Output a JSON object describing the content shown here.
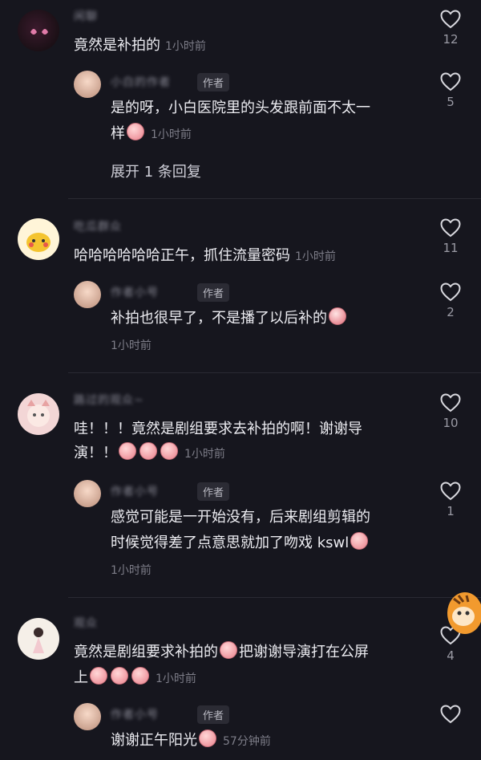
{
  "author_tag": "作者",
  "threads": [
    {
      "name": "闲聊",
      "text": "竟然是补拍的",
      "time": "1小时前",
      "likes": "12",
      "reply": {
        "name": "小白的作者",
        "text_line1": "是的呀，小白医院里的头发跟前面不太一",
        "text_line2": "样",
        "time": "1小时前",
        "likes": "5"
      },
      "expand": "展开 1 条回复"
    },
    {
      "name": "吃瓜群众",
      "text": "哈哈哈哈哈哈正午，抓住流量密码",
      "time": "1小时前",
      "likes": "11",
      "reply": {
        "name": "作者小号",
        "text": "补拍也很早了，不是播了以后补的",
        "time": "1小时前",
        "likes": "2"
      }
    },
    {
      "name": "路过的观众~",
      "text_line1": "哇！！！竟然是剧组要求去补拍的啊！谢谢导",
      "text_line2": "演！！",
      "time": "1小时前",
      "likes": "10",
      "reply": {
        "name": "作者小号",
        "text_line1": "感觉可能是一开始没有，后来剧组剪辑的",
        "text_line2": "时候觉得差了点意思就加了吻戏 kswl",
        "time": "1小时前",
        "likes": "1"
      }
    },
    {
      "name": "观众",
      "text_line1": "竟然是剧组要求补拍的",
      "text_line1b": "把谢谢导演打在公屏",
      "text_line2": "上",
      "time": "1小时前",
      "likes": "4",
      "reply": {
        "name": "作者小号",
        "text": "谢谢正午阳光",
        "time": "57分钟前"
      }
    }
  ],
  "colors": {
    "background": "#16161e",
    "text": "#ececf1",
    "muted": "#7d7d88",
    "divider": "#2a2a33"
  },
  "icons": [
    "heart-outline-icon",
    "avatar",
    "emoji-sticker"
  ]
}
